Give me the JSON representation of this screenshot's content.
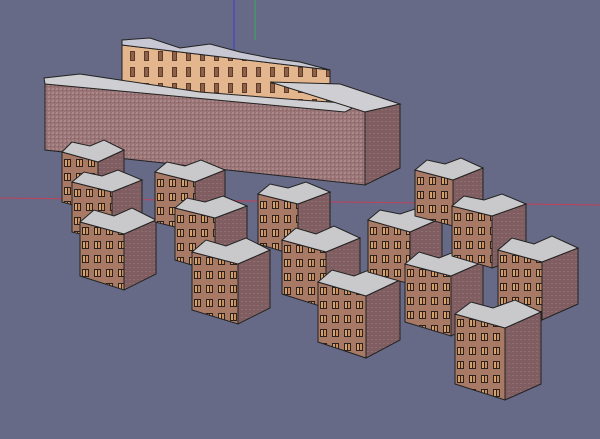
{
  "viewport": {
    "background": "#666a86",
    "axis_colors": {
      "red": "#c0415a",
      "green": "#3aa55a",
      "blue": "#3b3bd0"
    }
  },
  "model": {
    "facade_colors": {
      "brick": "#9c7578",
      "lit_wall": "#e3b48b",
      "roof": "#c9c9cc",
      "roof_shade": "#a9a9b2",
      "windows": "#3a2a22"
    }
  }
}
